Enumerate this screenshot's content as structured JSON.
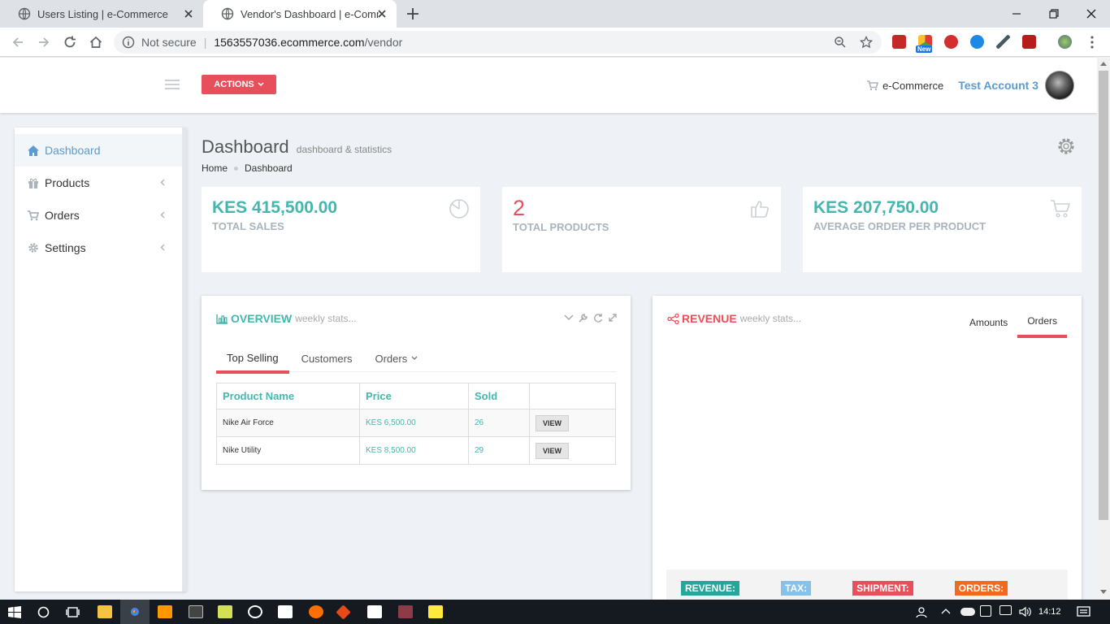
{
  "browser": {
    "tabs": [
      {
        "title": "Users Listing | e-Commerce",
        "active": false
      },
      {
        "title": "Vendor's Dashboard | e-Commerce",
        "active": true
      }
    ],
    "security": "Not secure",
    "url_host": "1563557036.ecommerce.com",
    "url_path": "/vendor",
    "extension_badge": "New"
  },
  "header": {
    "actions_label": "ACTIONS",
    "shop_label": "e-Commerce",
    "user_name": "Test Account 3"
  },
  "sidebar": {
    "items": [
      {
        "label": "Dashboard",
        "icon": "home-icon",
        "active": true
      },
      {
        "label": "Products",
        "icon": "gift-icon",
        "active": false
      },
      {
        "label": "Orders",
        "icon": "cart-icon",
        "active": false
      },
      {
        "label": "Settings",
        "icon": "gear-icon",
        "active": false
      }
    ]
  },
  "page": {
    "title": "Dashboard",
    "subtitle": "dashboard & statistics",
    "breadcrumb": [
      "Home",
      "Dashboard"
    ]
  },
  "stats": [
    {
      "value": "KES 415,500.00",
      "label": "TOTAL SALES",
      "icon": "pie-chart-icon"
    },
    {
      "value": "2",
      "label": "TOTAL PRODUCTS",
      "icon": "thumbs-up-icon"
    },
    {
      "value": "KES 207,750.00",
      "label": "AVERAGE ORDER PER PRODUCT",
      "icon": "cart-icon"
    }
  ],
  "overview": {
    "title": "OVERVIEW",
    "subtitle": "weekly stats...",
    "tabs": [
      "Top Selling",
      "Customers",
      "Orders"
    ],
    "columns": [
      "Product Name",
      "Price",
      "Sold",
      ""
    ],
    "rows": [
      {
        "name": "Nike Air Force",
        "price": "KES 6,500.00",
        "sold": "26",
        "action": "VIEW"
      },
      {
        "name": "Nike Utility",
        "price": "KES 8,500.00",
        "sold": "29",
        "action": "VIEW"
      }
    ]
  },
  "revenue": {
    "title": "REVENUE",
    "subtitle": "weekly stats...",
    "tabs": [
      "Amounts",
      "Orders"
    ],
    "badges": [
      {
        "label": "REVENUE:",
        "color": "#26a69a"
      },
      {
        "label": "TAX:",
        "color": "#85c1e9"
      },
      {
        "label": "SHIPMENT:",
        "color": "#e7505a"
      },
      {
        "label": "ORDERS:",
        "color": "#f36a1e"
      }
    ]
  },
  "taskbar": {
    "time": "14:12"
  },
  "colors": {
    "accent_green": "#44b6ae",
    "accent_red": "#e7505a",
    "accent_blue": "#5b9bd1"
  }
}
